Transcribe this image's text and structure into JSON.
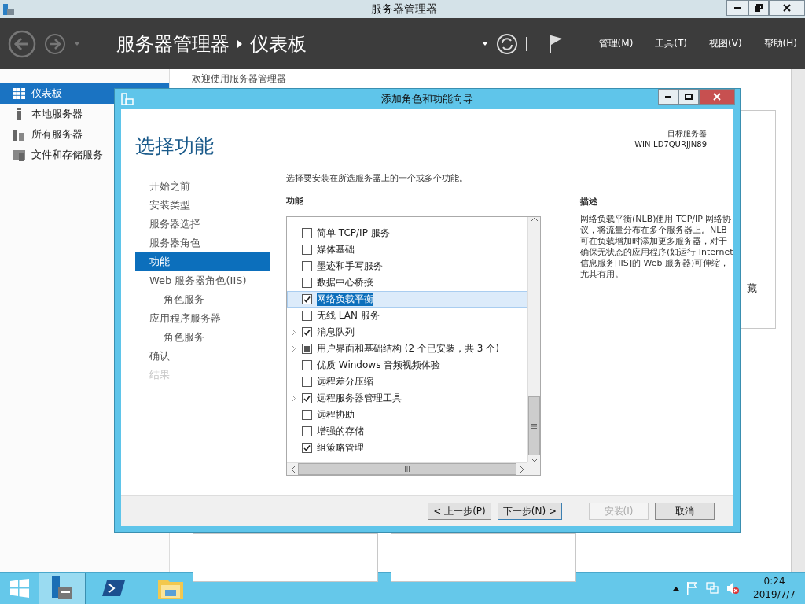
{
  "window": {
    "title": "服务器管理器"
  },
  "toolbar": {
    "breadcrumb": [
      "服务器管理器",
      "仪表板"
    ],
    "menus": [
      "管理(M)",
      "工具(T)",
      "视图(V)",
      "帮助(H)"
    ]
  },
  "sidebar": {
    "items": [
      {
        "label": "仪表板",
        "selected": true
      },
      {
        "label": "本地服务器",
        "selected": false
      },
      {
        "label": "所有服务器",
        "selected": false
      },
      {
        "label": "文件和存储服务",
        "selected": false
      }
    ]
  },
  "dashboard": {
    "heading": "欢迎使用服务器管理器",
    "fragment": "藏"
  },
  "dialog": {
    "title": "添加角色和功能向导",
    "heading": "选择功能",
    "target_label": "目标服务器",
    "target_name": "WIN-LD7QURJJN89",
    "steps": [
      {
        "label": "开始之前",
        "selected": false,
        "disabled": false
      },
      {
        "label": "安装类型",
        "selected": false,
        "disabled": false
      },
      {
        "label": "服务器选择",
        "selected": false,
        "disabled": false
      },
      {
        "label": "服务器角色",
        "selected": false,
        "disabled": false
      },
      {
        "label": "功能",
        "selected": true,
        "disabled": false
      },
      {
        "label": "Web 服务器角色(IIS)",
        "selected": false,
        "disabled": false,
        "children": [
          {
            "label": "角色服务",
            "selected": false,
            "disabled": false
          }
        ]
      },
      {
        "label": "应用程序服务器",
        "selected": false,
        "disabled": false,
        "children": [
          {
            "label": "角色服务",
            "selected": false,
            "disabled": false
          }
        ]
      },
      {
        "label": "确认",
        "selected": false,
        "disabled": false
      },
      {
        "label": "结果",
        "selected": false,
        "disabled": true
      }
    ],
    "instruction": "选择要安装在所选服务器上的一个或多个功能。",
    "features_label": "功能",
    "features": [
      {
        "label": "简单 TCP/IP 服务",
        "checked": false,
        "partial": false,
        "expandable": false,
        "selected": false
      },
      {
        "label": "媒体基础",
        "checked": false,
        "partial": false,
        "expandable": false,
        "selected": false
      },
      {
        "label": "墨迹和手写服务",
        "checked": false,
        "partial": false,
        "expandable": false,
        "selected": false
      },
      {
        "label": "数据中心桥接",
        "checked": false,
        "partial": false,
        "expandable": false,
        "selected": false
      },
      {
        "label": "网络负载平衡",
        "checked": true,
        "partial": false,
        "expandable": false,
        "selected": true
      },
      {
        "label": "无线 LAN 服务",
        "checked": false,
        "partial": false,
        "expandable": false,
        "selected": false
      },
      {
        "label": "消息队列",
        "checked": true,
        "partial": false,
        "expandable": true,
        "selected": false
      },
      {
        "label": "用户界面和基础结构 (2 个已安装，共 3 个)",
        "checked": false,
        "partial": true,
        "expandable": true,
        "selected": false
      },
      {
        "label": "优质 Windows 音频视频体验",
        "checked": false,
        "partial": false,
        "expandable": false,
        "selected": false
      },
      {
        "label": "远程差分压缩",
        "checked": false,
        "partial": false,
        "expandable": false,
        "selected": false
      },
      {
        "label": "远程服务器管理工具",
        "checked": true,
        "partial": false,
        "expandable": true,
        "selected": false
      },
      {
        "label": "远程协助",
        "checked": false,
        "partial": false,
        "expandable": false,
        "selected": false
      },
      {
        "label": "增强的存储",
        "checked": false,
        "partial": false,
        "expandable": false,
        "selected": false
      },
      {
        "label": "组策略管理",
        "checked": true,
        "partial": false,
        "expandable": false,
        "selected": false
      }
    ],
    "description_label": "描述",
    "description": "网络负载平衡(NLB)使用 TCP/IP 网络协议，将流量分布在多个服务器上。NLB 可在负载增加时添加更多服务器，对于确保无状态的应用程序(如运行 Internet 信息服务[IIS]的 Web 服务器)可伸缩，尤其有用。",
    "buttons": [
      {
        "label": "< 上一步(P)",
        "disabled": false,
        "focused": false
      },
      {
        "label": "下一步(N) >",
        "disabled": false,
        "focused": true
      },
      {
        "label": "安装(I)",
        "disabled": true,
        "focused": false
      },
      {
        "label": "取消",
        "disabled": false,
        "focused": false
      }
    ]
  },
  "taskbar": {
    "apps": [
      {
        "kind": "server",
        "selected": true
      },
      {
        "kind": "powershell",
        "selected": false
      },
      {
        "kind": "explorer",
        "selected": false
      }
    ],
    "time": "0:24",
    "date": "2019/7/7"
  }
}
